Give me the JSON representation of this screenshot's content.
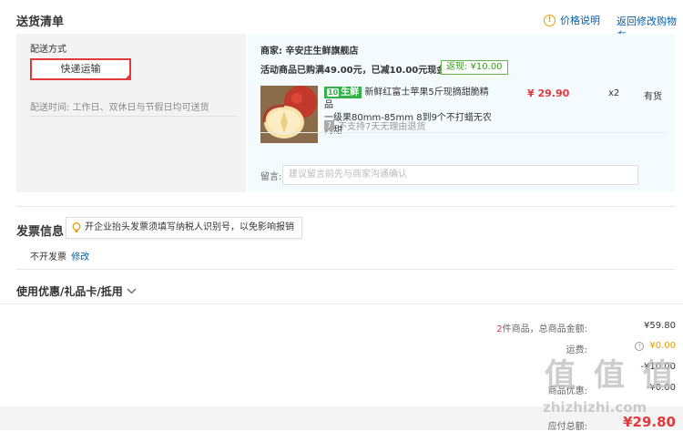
{
  "header": {
    "title": "送货清单",
    "price_note": "价格说明",
    "back_link": "返回修改购物车"
  },
  "shipping": {
    "label": "配送方式",
    "method": "快递运输",
    "time_label": "配送时间:",
    "time_value": "工作日、双休日与节假日均可送货"
  },
  "store": {
    "name": "商家: 辛安庄生鲜旗舰店",
    "promo": "活动商品已购满49.00元，已减10.00元现金",
    "rebate": "返现: ¥10.00",
    "product": {
      "tag": "生鲜",
      "tag_prefix": "10",
      "title_line1": "新鲜红富士苹果5斤现摘甜脆精品",
      "title_line2": "一级果80mm-85mm 8到9个不打蜡无农药甜",
      "price": "¥ 29.90",
      "qty": "x2",
      "stock": "有货",
      "return_policy": "不支持7天无理由退货"
    },
    "message_label": "留言:",
    "message_placeholder": "建议留言前先与商家沟通确认"
  },
  "invoice": {
    "title": "发票信息",
    "tip": "开企业抬头发票须填写纳税人识别号，以免影响报销",
    "status": "不开发票",
    "edit": "修改"
  },
  "coupon": {
    "title": "使用优惠/礼品卡/抵用"
  },
  "summary": {
    "count": "2",
    "count_suffix": "件商品，总商品金额:",
    "total_goods": "¥59.80",
    "freight_label": "运费:",
    "freight_value": "¥0.00",
    "row3_value": "-¥10.00",
    "row4_label": "商品优惠:",
    "row4_value": "-¥0.00",
    "payable_label": "应付总额:",
    "payable_value": "¥29.80"
  },
  "watermark": {
    "logo": "值 值 值",
    "url": "zhizhizhi.com"
  },
  "colors": {
    "accent_red": "#e4393c",
    "link_blue": "#005ea7",
    "fresh_green": "#34b24a"
  }
}
